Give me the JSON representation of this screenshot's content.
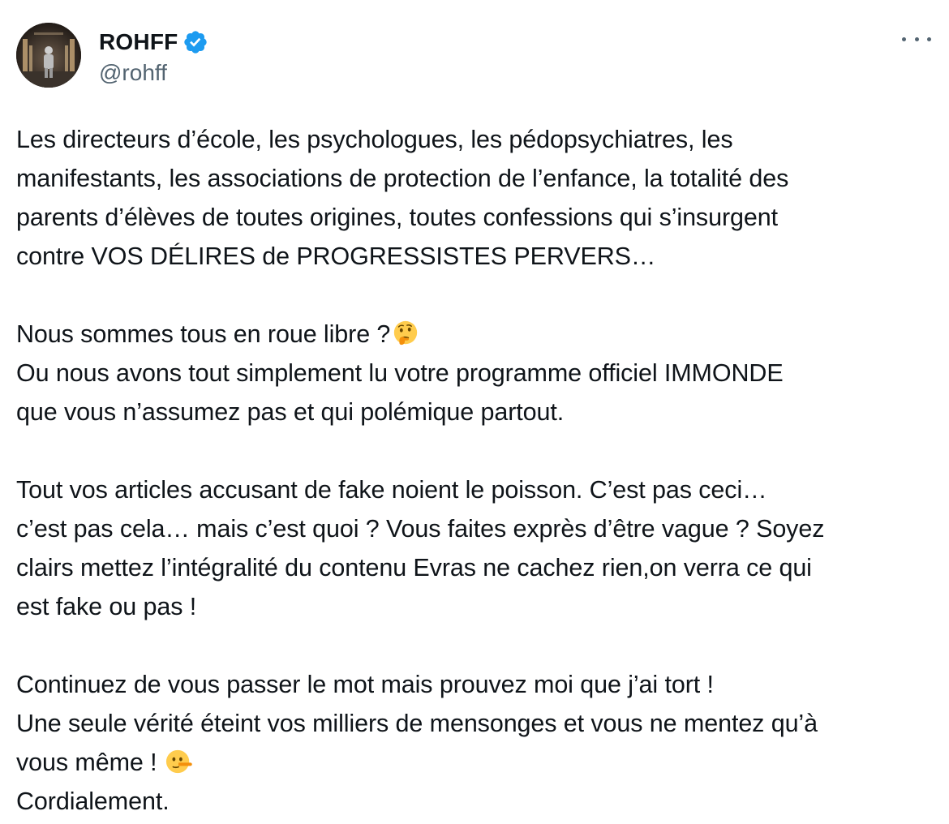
{
  "tweet": {
    "author": {
      "display_name": "ROHFF",
      "handle": "@rohff",
      "verified": true,
      "avatar_icon": "avatar-photo"
    },
    "more_icon": "more-horizontal-icon",
    "accent_color": "#1d9bf0",
    "text_color": "#0f1419",
    "muted_color": "#536471",
    "paragraphs": [
      {
        "lines": [
          "Les directeurs d’école, les psychologues, les pédopsychiatres, les",
          "manifestants, les associations de protection de l’enfance, la totalité des",
          "parents d’élèves de toutes origines, toutes confessions qui s’insurgent",
          "contre VOS DÉLIRES de PROGRESSISTES PERVERS…"
        ]
      },
      {
        "line1": "Nous sommes tous en roue libre ?",
        "line1_emoji": "thinking-face-emoji",
        "line2": "Ou nous avons tout simplement lu votre programme officiel IMMONDE",
        "line3": "que vous n’assumez pas et qui polémique partout."
      },
      {
        "lines": [
          "Tout vos articles accusant de fake noient le poisson. C’est pas ceci…",
          "c’est pas cela… mais c’est quoi ? Vous faites exprès d’être vague ? Soyez",
          "clairs mettez l’intégralité du contenu Evras ne cachez rien,on verra ce qui",
          "est fake ou pas !"
        ]
      },
      {
        "line1": "Continuez de vous passer le mot mais prouvez moi que j’ai tort !",
        "line2": "Une seule vérité éteint vos milliers de mensonges et vous ne mentez qu’à",
        "line3": "vous même !",
        "line3_emoji": "lying-face-emoji",
        "line4": "Cordialement."
      }
    ]
  }
}
